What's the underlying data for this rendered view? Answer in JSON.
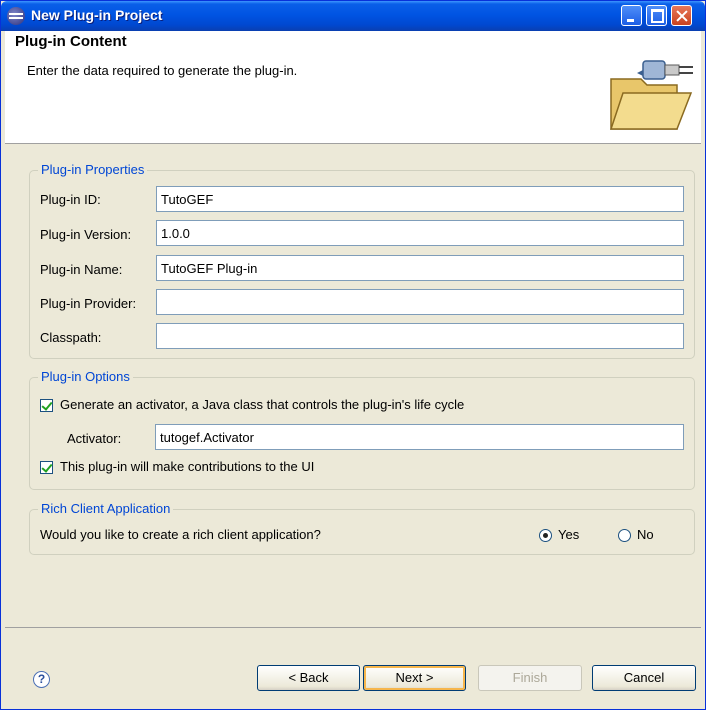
{
  "window": {
    "title": "New Plug-in Project"
  },
  "header": {
    "title": "Plug-in Content",
    "description": "Enter the data required to generate the plug-in."
  },
  "properties": {
    "title": "Plug-in Properties",
    "fields": [
      {
        "label": "Plug-in ID:",
        "value": "TutoGEF"
      },
      {
        "label": "Plug-in Version:",
        "value": "1.0.0"
      },
      {
        "label": "Plug-in Name:",
        "value": "TutoGEF Plug-in"
      },
      {
        "label": "Plug-in Provider:",
        "value": ""
      },
      {
        "label": "Classpath:",
        "value": ""
      }
    ]
  },
  "options": {
    "title": "Plug-in Options",
    "generate_activator_label": "Generate an activator, a Java class that controls the plug-in's life cycle",
    "generate_activator_checked": true,
    "activator_label": "Activator:",
    "activator_value": "tutogef.Activator",
    "ui_contrib_label": "This plug-in will make contributions to the UI",
    "ui_contrib_checked": true
  },
  "rcp": {
    "title": "Rich Client Application",
    "question": "Would you like to create a rich client application?",
    "yes_label": "Yes",
    "no_label": "No",
    "selected": "Yes"
  },
  "buttons": {
    "back": "< Back",
    "next": "Next >",
    "finish": "Finish",
    "cancel": "Cancel"
  },
  "icons": {
    "window": "eclipse-icon",
    "wizard": "plugin-folder-icon",
    "help": "help-icon"
  }
}
